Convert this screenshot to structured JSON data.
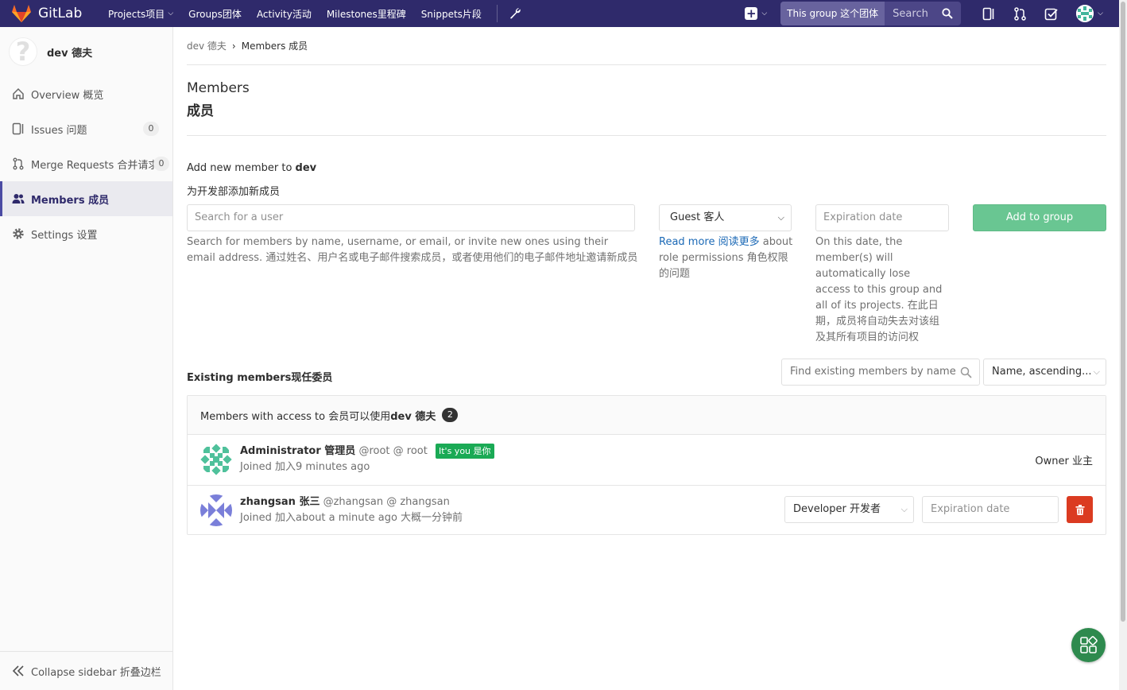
{
  "topbar": {
    "brand": "GitLab",
    "nav": [
      {
        "label": "Projects项目",
        "dropdown": true
      },
      {
        "label": "Groups团体",
        "dropdown": false
      },
      {
        "label": "Activity活动",
        "dropdown": false
      },
      {
        "label": "Milestones里程碑",
        "dropdown": false
      },
      {
        "label": "Snippets片段",
        "dropdown": false
      }
    ],
    "search_scope": "This group 这个团体",
    "search_placeholder": "Search"
  },
  "sidebar": {
    "group_name": "dev 德夫",
    "items": [
      {
        "label": "Overview 概览",
        "icon": "home-icon",
        "count": null
      },
      {
        "label": "Issues 问题",
        "icon": "issues-icon",
        "count": "0"
      },
      {
        "label": "Merge Requests 合并请求",
        "icon": "merge-request-icon",
        "count": "0"
      },
      {
        "label": "Members 成员",
        "icon": "users-icon",
        "count": null,
        "active": true
      },
      {
        "label": "Settings 设置",
        "icon": "gear-icon",
        "count": null
      }
    ],
    "collapse_label": "Collapse sidebar 折叠边栏"
  },
  "breadcrumb": {
    "parent": "dev 德夫",
    "current": "Members 成员"
  },
  "page": {
    "title_en": "Members",
    "title_zh": "成员"
  },
  "add_member": {
    "title_prefix": "Add new member to ",
    "group": "dev",
    "title_zh": "为开发部添加新成员",
    "search_placeholder": "Search for a user",
    "search_help": "Search for members by name, username, or email, or invite new ones using their email address. 通过姓名、用户名或电子邮件搜索成员，或者使用他们的电子邮件地址邀请新成员",
    "role_selected": "Guest 客人",
    "read_more": "Read more 阅读更多",
    "role_help": " about role permissions 角色权限的问题",
    "expiration_placeholder": "Expiration date",
    "expiration_help": "On this date, the member(s) will automatically lose access to this group and all of its projects. 在此日期，成员将自动失去对该组及其所有项目的访问权",
    "add_button": "Add to group"
  },
  "existing": {
    "title": "Existing members现任委员",
    "filter_placeholder": "Find existing members by name",
    "sort_label": "Name, ascending..."
  },
  "members_panel": {
    "header_prefix": "Members with access to 会员可以使用",
    "header_group": "dev 德夫",
    "count": "2",
    "members": [
      {
        "name": "Administrator 管理员",
        "handle": "@root @ root",
        "badge": "It's you 是你",
        "joined": "Joined 加入9 minutes ago",
        "role": "Owner 业主"
      },
      {
        "name": "zhangsan 张三",
        "handle": "@zhangsan @ zhangsan",
        "joined": "Joined 加入about a minute ago 大概一分钟前",
        "role": "Developer 开发者",
        "expiration_placeholder": "Expiration date"
      }
    ]
  },
  "colors": {
    "topbar": "#2f2a6b",
    "add_button": "#69c692",
    "delete_button": "#db3b21",
    "you_badge": "#1aaa55",
    "link": "#1b69b6"
  }
}
